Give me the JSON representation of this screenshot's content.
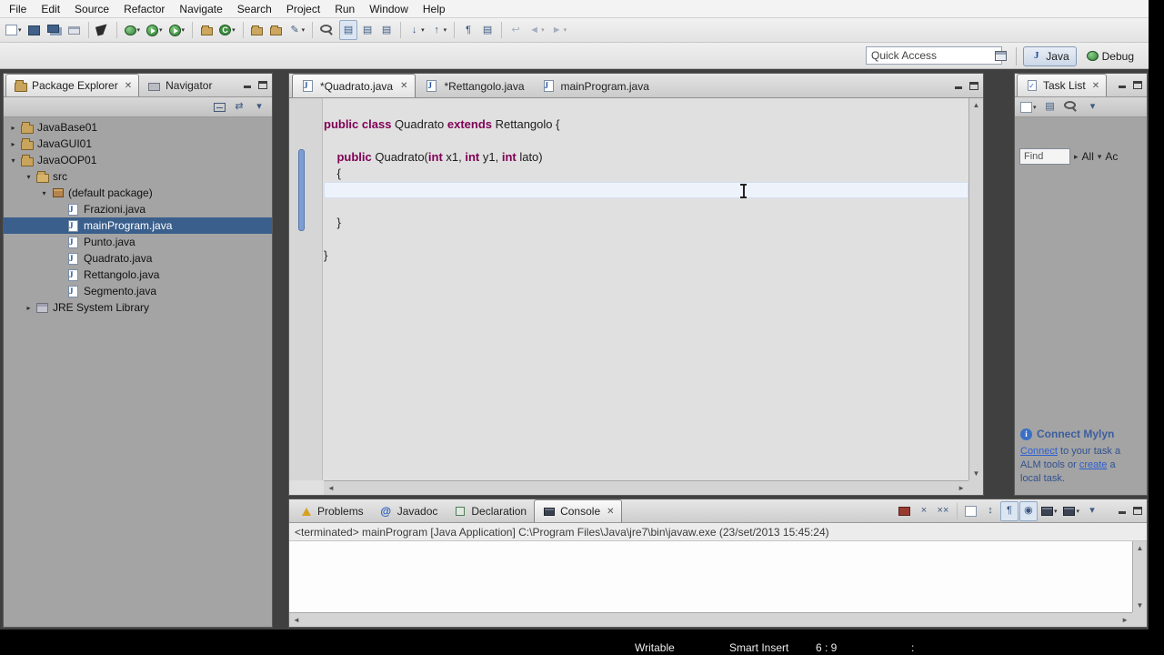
{
  "colors": {
    "keyword": "#7f0055",
    "selection": "#3a5f8c",
    "link": "#2a5fd4",
    "change_bar": "#7d9ed2",
    "current_line": "#eef3fb"
  },
  "menu_bar": {
    "items": [
      "File",
      "Edit",
      "Source",
      "Refactor",
      "Navigate",
      "Search",
      "Project",
      "Run",
      "Window",
      "Help"
    ]
  },
  "main_toolbar": {
    "icons": [
      {
        "name": "new-wizard",
        "shape": "page",
        "dropdown": true
      },
      {
        "name": "save",
        "shape": "save"
      },
      {
        "name": "save-all",
        "shape": "save-all"
      },
      {
        "name": "print",
        "shape": "print"
      },
      {
        "sep": true
      },
      {
        "name": "cursor-mode",
        "shape": "cursor"
      },
      {
        "sep": true
      },
      {
        "name": "debug",
        "shape": "bug",
        "dropdown": true
      },
      {
        "name": "run",
        "shape": "run",
        "dropdown": true
      },
      {
        "name": "run-external-tools",
        "shape": "run",
        "dropdown": true
      },
      {
        "sep": true
      },
      {
        "name": "new-java-project",
        "shape": "folder"
      },
      {
        "name": "new-java-class",
        "shape": "class",
        "dropdown": true
      },
      {
        "sep": true
      },
      {
        "name": "open-task",
        "shape": "folder"
      },
      {
        "name": "activate-task",
        "shape": "folder"
      },
      {
        "name": "edit-task",
        "shape": "pencil",
        "dropdown": true
      },
      {
        "sep": true
      },
      {
        "name": "search",
        "shape": "search"
      },
      {
        "name": "mark-occurrences",
        "shape": "grid",
        "pressed": true
      },
      {
        "name": "show-annotations",
        "shape": "grid"
      },
      {
        "name": "open-type-hierarchy",
        "shape": "grid"
      },
      {
        "sep": true
      },
      {
        "name": "next-annotation",
        "shape": "down",
        "dropdown": true
      },
      {
        "name": "previous-annotation",
        "shape": "up",
        "dropdown": true
      },
      {
        "sep": true
      },
      {
        "name": "show-whitespace",
        "shape": "para"
      },
      {
        "name": "coverage",
        "shape": "grid"
      },
      {
        "sep": true
      },
      {
        "name": "last-edit-location",
        "shape": "back",
        "grayed": true
      },
      {
        "name": "back-history",
        "shape": "left",
        "dropdown": true,
        "grayed": true
      },
      {
        "name": "forward-history",
        "shape": "right",
        "dropdown": true,
        "grayed": true
      }
    ]
  },
  "quick_access": {
    "value": "Quick Access"
  },
  "perspective_bar": {
    "java": "Java",
    "debug": "Debug"
  },
  "package_explorer": {
    "title": "Package Explorer",
    "navigator": "Navigator",
    "tools": [
      {
        "name": "collapse-all",
        "shape": "collapse"
      },
      {
        "name": "link-with-editor",
        "shape": "link"
      },
      {
        "name": "package-explorer-view-menu",
        "shape": "menu"
      }
    ],
    "tree": [
      {
        "label": "JavaBase01",
        "level": 0,
        "type": "project",
        "children": true,
        "expanded": false
      },
      {
        "label": "JavaGUI01",
        "level": 0,
        "type": "project",
        "children": true,
        "expanded": false
      },
      {
        "label": "JavaOOP01",
        "level": 0,
        "type": "project",
        "children": true,
        "expanded": true
      },
      {
        "label": "src",
        "level": 1,
        "type": "src",
        "children": true,
        "expanded": true
      },
      {
        "label": "(default package)",
        "level": 2,
        "type": "package",
        "children": true,
        "expanded": true
      },
      {
        "label": "Frazioni.java",
        "level": 3,
        "type": "java"
      },
      {
        "label": "mainProgram.java",
        "level": 3,
        "type": "java",
        "selected": true
      },
      {
        "label": "Punto.java",
        "level": 3,
        "type": "java"
      },
      {
        "label": "Quadrato.java",
        "level": 3,
        "type": "java"
      },
      {
        "label": "Rettangolo.java",
        "level": 3,
        "type": "java"
      },
      {
        "label": "Segmento.java",
        "level": 3,
        "type": "java"
      },
      {
        "label": "JRE System Library",
        "level": 1,
        "type": "library",
        "children": true,
        "expanded": false
      }
    ]
  },
  "editor": {
    "tabs": [
      {
        "label": "*Quadrato.java",
        "active": true,
        "dirty": true
      },
      {
        "label": "*Rettangolo.java",
        "dirty": true
      },
      {
        "label": "mainProgram.java"
      }
    ],
    "code": [
      {
        "tokens": [
          {
            "t": "public class ",
            "k": 1
          },
          {
            "t": "Quadrato ",
            "k": 0
          },
          {
            "t": "extends",
            "k": 1
          },
          {
            "t": " Rettangolo {",
            "k": 0
          }
        ]
      },
      {
        "tokens": []
      },
      {
        "tokens": [
          {
            "t": "    ",
            "k": 0
          },
          {
            "t": "public",
            "k": 1
          },
          {
            "t": " Quadrato(",
            "k": 0
          },
          {
            "t": "int",
            "k": 1
          },
          {
            "t": " x1, ",
            "k": 0
          },
          {
            "t": "int",
            "k": 1
          },
          {
            "t": " y1, ",
            "k": 0
          },
          {
            "t": "int",
            "k": 1
          },
          {
            "t": " lato)",
            "k": 0
          }
        ]
      },
      {
        "tokens": [
          {
            "t": "    {",
            "k": 0
          }
        ]
      },
      {
        "tokens": [],
        "hl": true
      },
      {
        "tokens": []
      },
      {
        "tokens": [
          {
            "t": "    }",
            "k": 0
          }
        ]
      },
      {
        "tokens": []
      },
      {
        "tokens": [
          {
            "t": "}",
            "k": 0
          }
        ]
      }
    ]
  },
  "task_list": {
    "title": "Task List",
    "tools": [
      {
        "name": "new-task",
        "shape": "page",
        "dropdown": true
      },
      {
        "name": "categorized-presentation",
        "shape": "grid"
      },
      {
        "name": "filter-tasks",
        "shape": "search"
      },
      {
        "name": "task-list-view-menu",
        "shape": "menu"
      }
    ],
    "find": {
      "placeholder": "Find",
      "scope_all": "All",
      "activate": "Ac"
    },
    "mylyn": {
      "title": "Connect Mylyn",
      "lines": [
        [
          {
            "t": "Connect",
            "link": true
          },
          {
            "t": " to your task a"
          }
        ],
        [
          {
            "t": "ALM tools or "
          },
          {
            "t": "create",
            "link": true
          },
          {
            "t": " a"
          }
        ],
        [
          {
            "t": "local task."
          }
        ]
      ]
    }
  },
  "console": {
    "tabs": [
      {
        "label": "Problems",
        "icon": "prob"
      },
      {
        "label": "Javadoc",
        "icon": "at"
      },
      {
        "label": "Declaration",
        "icon": "decl"
      },
      {
        "label": "Console",
        "icon": "cons",
        "active": true
      }
    ],
    "toolbar": [
      {
        "name": "terminate",
        "shape": "stop"
      },
      {
        "name": "remove-launch",
        "shape": "x"
      },
      {
        "name": "remove-all-launches",
        "shape": "xx"
      },
      {
        "sep": true
      },
      {
        "name": "clear-console",
        "shape": "page"
      },
      {
        "name": "scroll-lock",
        "shape": "scroll"
      },
      {
        "name": "word-wrap",
        "shape": "para",
        "pressed": true
      },
      {
        "name": "pin-console",
        "shape": "pin",
        "pressed": true
      },
      {
        "name": "display-selected-console",
        "shape": "console",
        "dropdown": true
      },
      {
        "name": "open-console",
        "shape": "console",
        "dropdown": true
      },
      {
        "name": "console-view-menu",
        "shape": "menu"
      }
    ],
    "header": "<terminated> mainProgram [Java Application] C:\\Program Files\\Java\\jre7\\bin\\javaw.exe (23/set/2013 15:45:24)"
  },
  "status_bar": {
    "writable": "Writable",
    "insert_mode": "Smart Insert",
    "cursor_position": "6 : 9",
    "extra": ":"
  }
}
